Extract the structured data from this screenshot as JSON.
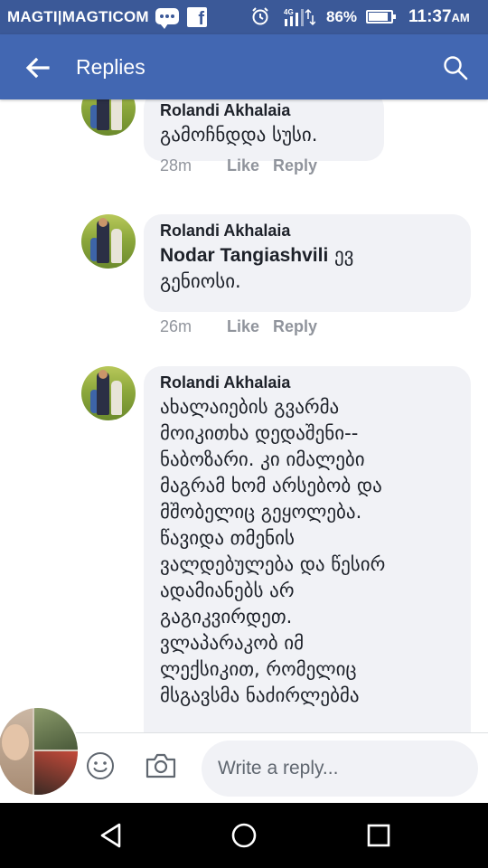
{
  "status_bar": {
    "carrier": "MAGTI|MAGTICOM",
    "battery_percent": "86%",
    "battery_level": 0.86,
    "time": "11:37",
    "ampm": "AM",
    "network": "4G",
    "icons": [
      "messenger-icon",
      "facebook-icon",
      "alarm-icon",
      "signal-icon",
      "battery-icon"
    ]
  },
  "app_bar": {
    "title": "Replies",
    "back_icon": "arrow-left-icon",
    "search_icon": "search-icon"
  },
  "comments": [
    {
      "author": "Rolandi Akhalaia",
      "mention": "",
      "text": "გამოჩნდდა სუსი.",
      "time": "28m",
      "like_label": "Like",
      "reply_label": "Reply"
    },
    {
      "author": "Rolandi Akhalaia",
      "mention": "Nodar Tangiashvili",
      "text": " ევ\nგენიოსი.",
      "time": "26m",
      "like_label": "Like",
      "reply_label": "Reply"
    },
    {
      "author": "Rolandi Akhalaia",
      "mention": "",
      "text": "ახალაიების გვარმა\nმოიკითხა დედაშენი--\nნაბოზარი.  კი იმალები\nმაგრამ ხომ არსებობ და\nმშობელიც გეყოლება.\nწავიდა თმენის\nვალდებულება და წესირ\nადამიანებს არ\nგაგიკვირდეთ.\nვლაპარაკობ იმ\nლექსიკით, რომელიც\nმსგავსმა ნაძირლებმა",
      "time": "",
      "like_label": "",
      "reply_label": ""
    }
  ],
  "composer": {
    "placeholder": "Write a reply...",
    "emoji_icon": "smiley-icon",
    "camera_icon": "camera-icon"
  },
  "nav_bar": {
    "icons": [
      "back-triangle-icon",
      "home-circle-icon",
      "recents-square-icon"
    ]
  },
  "colors": {
    "brand_blue": "#4267b2",
    "status_blue": "#3b5998",
    "bubble_gray": "#f1f2f6",
    "meta_gray": "#90949c"
  }
}
